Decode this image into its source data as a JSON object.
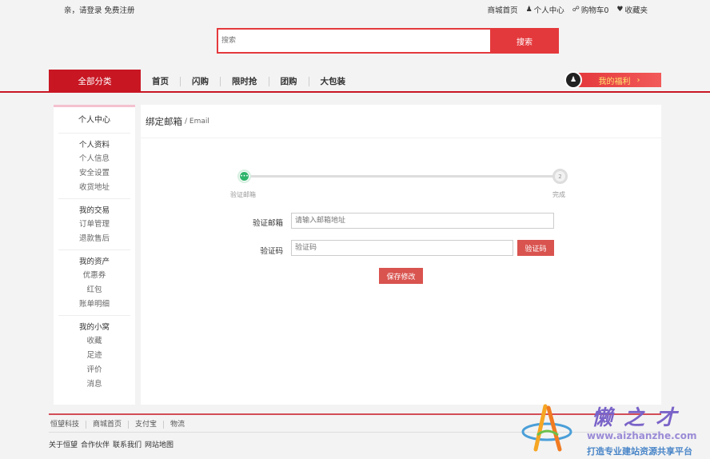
{
  "topbar": {
    "greeting": "亲，请登录",
    "register": "免费注册",
    "links": [
      {
        "label": "商城首页",
        "icon": ""
      },
      {
        "label": "个人中心",
        "icon": "user-icon"
      },
      {
        "label": "购物车0",
        "icon": "cart-icon"
      },
      {
        "label": "收藏夹",
        "icon": "heart-icon"
      }
    ]
  },
  "search": {
    "placeholder": "搜索",
    "button": "搜索"
  },
  "nav": {
    "all_categories": "全部分类",
    "links": [
      "首页",
      "闪购",
      "限时抢",
      "团购",
      "大包装"
    ],
    "welfare": "我的福利"
  },
  "sidebar": {
    "title": "个人中心",
    "groups": [
      {
        "head": "个人资料",
        "items": [
          "个人信息",
          "安全设置",
          "收货地址"
        ]
      },
      {
        "head": "我的交易",
        "items": [
          "订单管理",
          "退款售后"
        ]
      },
      {
        "head": "我的资产",
        "items": [
          "优惠券",
          "红包",
          "账单明细"
        ]
      },
      {
        "head": "我的小窝",
        "items": [
          "收藏",
          "足迹",
          "评价",
          "消息"
        ]
      }
    ]
  },
  "panel": {
    "title": "绑定邮箱",
    "subtitle": "/ Email",
    "steps": [
      {
        "label": "验证邮箱",
        "marker": "•••"
      },
      {
        "label": "完成",
        "marker": "2"
      }
    ],
    "form": {
      "email_label": "验证邮箱",
      "email_placeholder": "请输入邮箱地址",
      "code_label": "验证码",
      "code_placeholder": "验证码",
      "code_button": "验证码",
      "save_button": "保存修改"
    }
  },
  "footer": {
    "links": [
      "恒望科技",
      "商城首页",
      "支付宝",
      "物流"
    ],
    "about": [
      "关于恒望",
      "合作伙伴",
      "联系我们",
      "网站地图"
    ]
  },
  "watermark": {
    "brand": "懒之才",
    "url": "www.aizhanzhe.com",
    "slogan": "打造专业建站资源共享平台"
  }
}
